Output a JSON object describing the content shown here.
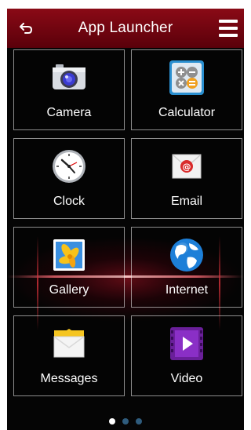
{
  "header": {
    "title": "App Launcher",
    "back_icon": "back-arrow-icon",
    "menu_icon": "hamburger-menu-icon"
  },
  "apps": [
    {
      "label": "Camera",
      "icon": "camera-icon"
    },
    {
      "label": "Calculator",
      "icon": "calculator-icon"
    },
    {
      "label": "Clock",
      "icon": "clock-icon"
    },
    {
      "label": "Email",
      "icon": "email-icon"
    },
    {
      "label": "Gallery",
      "icon": "gallery-icon"
    },
    {
      "label": "Internet",
      "icon": "globe-icon"
    },
    {
      "label": "Messages",
      "icon": "messages-icon"
    },
    {
      "label": "Video",
      "icon": "video-icon"
    }
  ],
  "pager": {
    "pages": 3,
    "active_index": 0
  },
  "colors": {
    "header": "#7a0612",
    "background": "#050505",
    "accent_glow": "#c8102e"
  }
}
